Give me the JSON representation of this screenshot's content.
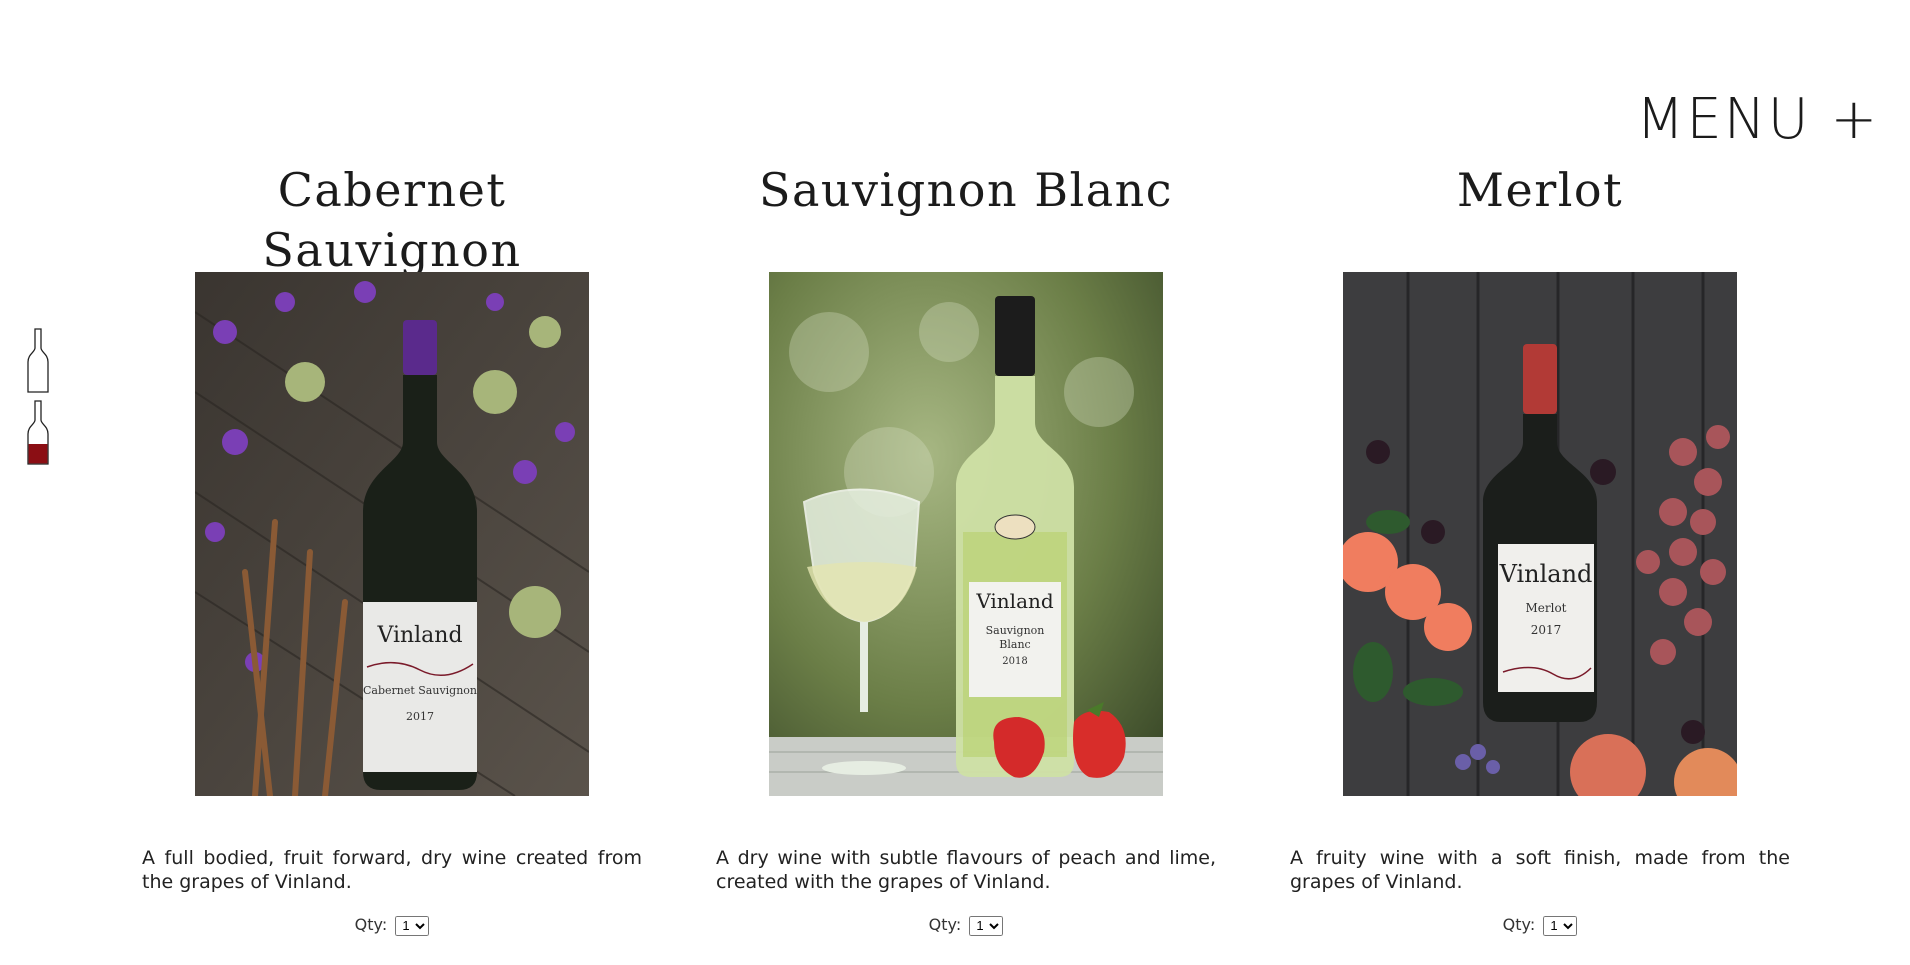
{
  "menu_label": "MENU +",
  "products": [
    {
      "name": "Cabernet Sauvignon",
      "description": "A full bodied, fruit forward, dry wine created from the grapes of Vinland.",
      "qty_label": "Qty:",
      "qty_value": "1",
      "label": {
        "brand": "Vinland",
        "variety": "Cabernet Sauvignon",
        "year": "2017"
      },
      "cap_color": "#5a2a8c"
    },
    {
      "name": "Sauvignon Blanc",
      "description": "A dry wine with subtle flavours of peach and lime, created with the grapes of Vinland.",
      "qty_label": "Qty:",
      "qty_value": "1",
      "label": {
        "brand": "Vinland",
        "variety_line1": "Sauvignon",
        "variety_line2": "Blanc",
        "year": "2018"
      },
      "cap_color": "#1c1c1c"
    },
    {
      "name": "Merlot",
      "description": "A fruity wine with a soft finish, made from the grapes of Vinland.",
      "qty_label": "Qty:",
      "qty_value": "1",
      "label": {
        "brand": "Vinland",
        "variety": "Merlot",
        "year": "2017"
      },
      "cap_color": "#b23a36"
    }
  ],
  "scroll_indicator": {
    "icon": "wine-bottle-icon",
    "fill_color": "#8b0e14"
  }
}
